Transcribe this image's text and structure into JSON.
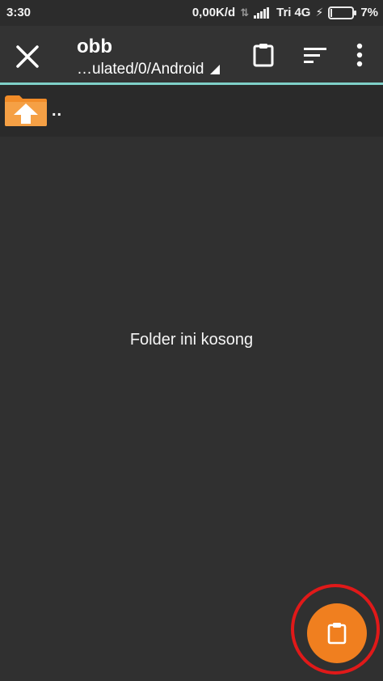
{
  "status_bar": {
    "time": "3:30",
    "net_speed": "0,00K/d",
    "carrier": "Tri",
    "network": "4G",
    "battery": "7%",
    "battery_level": 0.07
  },
  "toolbar": {
    "close_icon": "close-icon",
    "title": "obb",
    "path": "…ulated/0/Android",
    "path_dropdown_icon": "dropdown-triangle-icon",
    "clipboard_icon": "clipboard-icon",
    "sort_icon": "sort-icon",
    "more_icon": "more-vert-icon"
  },
  "up_item": {
    "icon": "folder-up-icon",
    "label": ".."
  },
  "empty_message": "Folder ini kosong",
  "fab": {
    "icon": "clipboard-icon",
    "color": "#f07f1f",
    "highlight_color": "#e01919"
  },
  "colors": {
    "background": "#303030",
    "toolbar": "#333333",
    "accent_line": "#7fd0c8",
    "folder": "#f28c28"
  }
}
